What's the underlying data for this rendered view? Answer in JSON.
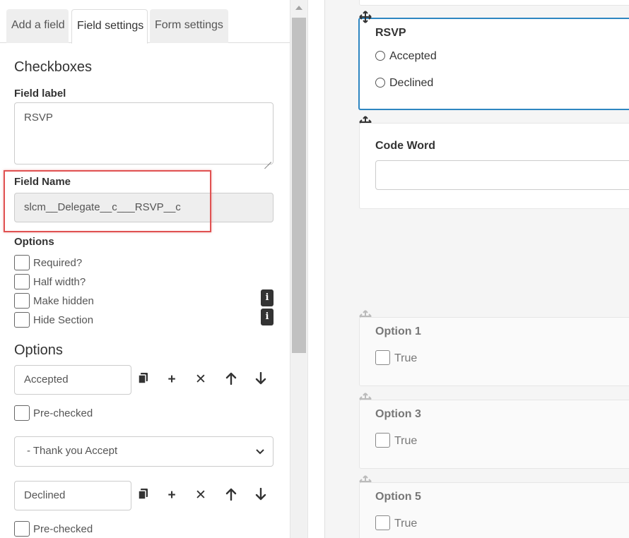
{
  "tabs": [
    {
      "label": "Add a field"
    },
    {
      "label": "Field settings"
    },
    {
      "label": "Form settings"
    }
  ],
  "field_settings": {
    "section_title": "Checkboxes",
    "field_label_heading": "Field label",
    "field_label_value": "RSVP",
    "field_name_heading": "Field Name",
    "field_name_value": "slcm__Delegate__c___RSVP__c",
    "options_heading": "Options",
    "checks": [
      {
        "label": "Required?"
      },
      {
        "label": "Half width?"
      },
      {
        "label": "Make hidden"
      },
      {
        "label": "Hide Section"
      }
    ],
    "options_title": "Options",
    "option_items": [
      {
        "value": "Accepted",
        "prechecked_label": "Pre-checked"
      },
      {
        "value": "Declined",
        "prechecked_label": "Pre-checked"
      }
    ],
    "select_value": "- Thank you Accept"
  },
  "canvas": {
    "rsvp": {
      "title": "RSVP",
      "options": [
        {
          "label": "Accepted"
        },
        {
          "label": "Declined"
        }
      ]
    },
    "code_word": {
      "title": "Code Word"
    },
    "option_cards": [
      {
        "title": "Option 1",
        "check_label": "True"
      },
      {
        "title": "Option 3",
        "check_label": "True"
      },
      {
        "title": "Option 5",
        "check_label": "True"
      }
    ]
  },
  "colors": {
    "selected_border": "#2e86c1",
    "highlight": "#e05252"
  }
}
